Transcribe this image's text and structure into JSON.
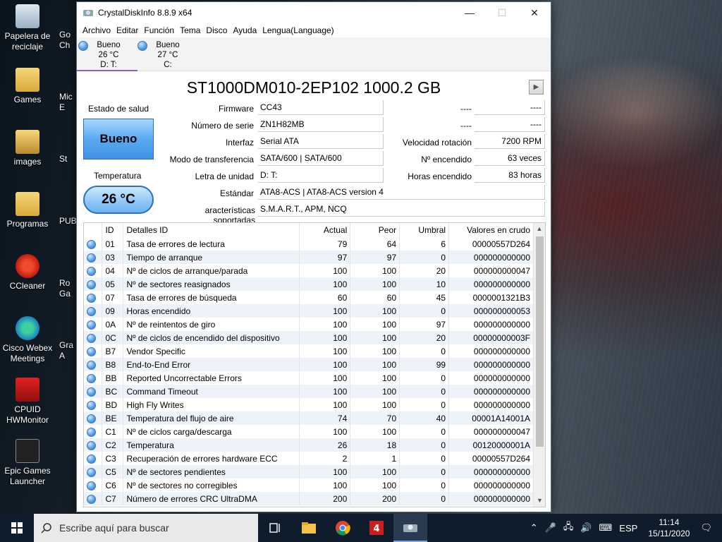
{
  "desktop": {
    "icons": [
      {
        "label": "Papelera de reciclaje"
      },
      {
        "label": "Games"
      },
      {
        "label": "images"
      },
      {
        "label": "Programas"
      },
      {
        "label": "CCleaner"
      },
      {
        "label": "Cisco Webex Meetings"
      },
      {
        "label": "CPUID HWMonitor"
      },
      {
        "label": "Epic Games Launcher"
      }
    ],
    "partial_labels": [
      "Go Ch",
      "Mic E",
      "St",
      "PUB",
      "Ro Ga",
      "Gra A"
    ]
  },
  "window": {
    "title": "CrystalDiskInfo 8.8.9 x64",
    "menu": [
      "Archivo",
      "Editar",
      "Función",
      "Tema",
      "Disco",
      "Ayuda",
      "Lengua(Language)"
    ],
    "drives": [
      {
        "status": "Bueno",
        "temp": "26 °C",
        "letter": "D: T:"
      },
      {
        "status": "Bueno",
        "temp": "27 °C",
        "letter": "C:"
      }
    ],
    "model": "ST1000DM010-2EP102 1000.2 GB",
    "health_label": "Estado de salud",
    "health_value": "Bueno",
    "temp_label": "Temperatura",
    "temp_value": "26 °C",
    "fields": {
      "firmware": {
        "label": "Firmware",
        "value": "CC43"
      },
      "serial": {
        "label": "Número de serie",
        "value": "ZN1H82MB"
      },
      "interface": {
        "label": "Interfaz",
        "value": "Serial ATA"
      },
      "transfer": {
        "label": "Modo de transferencia",
        "value": "SATA/600 | SATA/600"
      },
      "drive_letter": {
        "label": "Letra de unidad",
        "value": "D: T:"
      },
      "standard": {
        "label": "Estándar",
        "value": "ATA8-ACS | ATA8-ACS version 4"
      },
      "features": {
        "label": "aracterísticas soportadas",
        "value": "S.M.A.R.T., APM, NCQ"
      },
      "blank1": {
        "label": "----",
        "value": "----"
      },
      "blank2": {
        "label": "----",
        "value": "----"
      },
      "rotation": {
        "label": "Velocidad rotación",
        "value": "7200 RPM"
      },
      "power_count": {
        "label": "Nº encendido",
        "value": "63 veces"
      },
      "power_hours": {
        "label": "Horas encendido",
        "value": "83 horas"
      }
    },
    "table": {
      "headers": [
        "ID",
        "Detalles ID",
        "Actual",
        "Peor",
        "Umbral",
        "Valores en crudo"
      ],
      "rows": [
        [
          "01",
          "Tasa de errores de lectura",
          "79",
          "64",
          "6",
          "00000557D264"
        ],
        [
          "03",
          "Tiempo de arranque",
          "97",
          "97",
          "0",
          "000000000000"
        ],
        [
          "04",
          "Nº de ciclos de arranque/parada",
          "100",
          "100",
          "20",
          "000000000047"
        ],
        [
          "05",
          "Nº de sectores reasignados",
          "100",
          "100",
          "10",
          "000000000000"
        ],
        [
          "07",
          "Tasa de errores de búsqueda",
          "60",
          "60",
          "45",
          "0000001321B3"
        ],
        [
          "09",
          "Horas encendido",
          "100",
          "100",
          "0",
          "000000000053"
        ],
        [
          "0A",
          "Nº de reintentos de giro",
          "100",
          "100",
          "97",
          "000000000000"
        ],
        [
          "0C",
          "Nº de ciclos de encendido del dispositivo",
          "100",
          "100",
          "20",
          "00000000003F"
        ],
        [
          "B7",
          "Vendor Specific",
          "100",
          "100",
          "0",
          "000000000000"
        ],
        [
          "B8",
          "End-to-End Error",
          "100",
          "100",
          "99",
          "000000000000"
        ],
        [
          "BB",
          "Reported Uncorrectable Errors",
          "100",
          "100",
          "0",
          "000000000000"
        ],
        [
          "BC",
          "Command Timeout",
          "100",
          "100",
          "0",
          "000000000000"
        ],
        [
          "BD",
          "High Fly Writes",
          "100",
          "100",
          "0",
          "000000000000"
        ],
        [
          "BE",
          "Temperatura del flujo de aire",
          "74",
          "70",
          "40",
          "00001A14001A"
        ],
        [
          "C1",
          "Nº de ciclos carga/descarga",
          "100",
          "100",
          "0",
          "000000000047"
        ],
        [
          "C2",
          "Temperatura",
          "26",
          "18",
          "0",
          "00120000001A"
        ],
        [
          "C3",
          "Recuperación de errores hardware ECC",
          "2",
          "1",
          "0",
          "00000557D264"
        ],
        [
          "C5",
          "Nº de sectores pendientes",
          "100",
          "100",
          "0",
          "000000000000"
        ],
        [
          "C6",
          "Nº de sectores no corregibles",
          "100",
          "100",
          "0",
          "000000000000"
        ],
        [
          "C7",
          "Número de errores CRC UltraDMA",
          "200",
          "200",
          "0",
          "000000000000"
        ]
      ]
    }
  },
  "taskbar": {
    "search_placeholder": "Escribe aquí para buscar",
    "language": "ESP",
    "time": "11:14",
    "date": "15/11/2020"
  },
  "colors": {
    "good_blue": "#5aa9ef",
    "taskbar": "#0f1c2c"
  }
}
